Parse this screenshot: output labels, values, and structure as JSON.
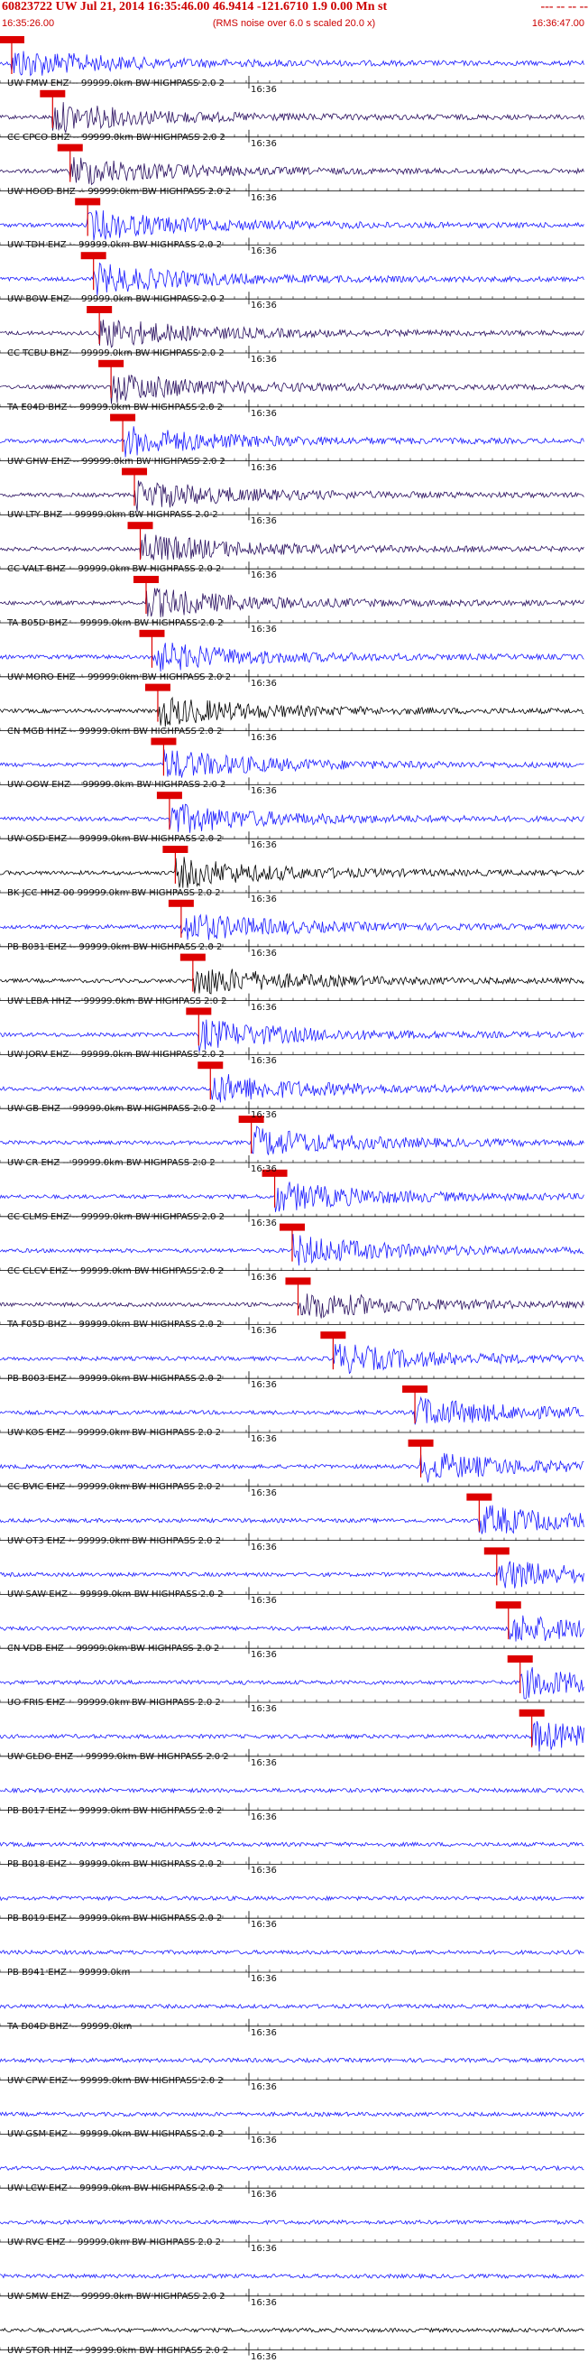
{
  "header": {
    "title": "60823722 UW Jul 21, 2014 16:35:46.00   46.9414 -121.6710  1.9 0.00 Mn st",
    "title_end": "--- -- -- --",
    "start_time": "16:35:26.00",
    "noise_note": "(RMS noise over 6.0 s scaled 20.0 x)",
    "end_time": "16:36:47.00"
  },
  "minute_label": "16:36",
  "colors": {
    "blue": "#1a1aff",
    "dark": "#2a1060",
    "black": "#000000",
    "pick": "#dd0000",
    "label_red": "#cc0000"
  },
  "traces": [
    {
      "label": "UW FMW EHZ -- 99999.0km BW  HIGHPASS  2.0  2",
      "color": "blue",
      "pick": 0.02
    },
    {
      "label": "CC CPCO BHZ -- 99999.0km BW  HIGHPASS  2.0  2",
      "color": "dark",
      "pick": 0.09
    },
    {
      "label": "UW HOOD BHZ -- 99999.0km BW  HIGHPASS  2.0  2",
      "color": "dark",
      "pick": 0.12
    },
    {
      "label": "UW TDH EHZ -- 99999.0km BW  HIGHPASS  2.0  2",
      "color": "blue",
      "pick": 0.15
    },
    {
      "label": "UW BOW EHZ -- 99999.0km BW  HIGHPASS  2.0  2",
      "color": "blue",
      "pick": 0.16
    },
    {
      "label": "CC TCBU BHZ -- 99999.0km BW  HIGHPASS  2.0  2",
      "color": "dark",
      "pick": 0.17
    },
    {
      "label": "TA E04D BHZ -- 99999.0km BW  HIGHPASS  2.0  2",
      "color": "dark",
      "pick": 0.19
    },
    {
      "label": "UW GHW EHZ -- 99999.0km BW  HIGHPASS  2.0  2",
      "color": "blue",
      "pick": 0.21
    },
    {
      "label": "UW LTY BHZ -- 99999.0km BW  HIGHPASS  2.0  2",
      "color": "dark",
      "pick": 0.23
    },
    {
      "label": "CC VALT BHZ -- 99999.0km BW  HIGHPASS  2.0  2",
      "color": "dark",
      "pick": 0.24
    },
    {
      "label": "TA B05D BHZ -- 99999.0km BW  HIGHPASS  2.0  2",
      "color": "dark",
      "pick": 0.25
    },
    {
      "label": "UW MORO EHZ -- 99999.0km BW  HIGHPASS  2.0  2",
      "color": "blue",
      "pick": 0.26
    },
    {
      "label": "CN MGB HHZ -- 99999.0km BW  HIGHPASS  2.0  2",
      "color": "black",
      "pick": 0.27
    },
    {
      "label": "UW OOW EHZ -- 99999.0km BW  HIGHPASS  2.0  2",
      "color": "blue",
      "pick": 0.28
    },
    {
      "label": "UW OSD EHZ -- 99999.0km BW  HIGHPASS  2.0  2",
      "color": "blue",
      "pick": 0.29
    },
    {
      "label": "BK JCC HHZ 00 99999.0km BW  HIGHPASS  2.0  2",
      "color": "black",
      "pick": 0.3
    },
    {
      "label": "PB B031 EHZ -- 99999.0km BW  HIGHPASS  2.0  2",
      "color": "blue",
      "pick": 0.31
    },
    {
      "label": "UW LEBA HHZ -- 99999.0km BW  HIGHPASS  2.0  2",
      "color": "black",
      "pick": 0.33
    },
    {
      "label": "UW JORV EHZ -- 99999.0km BW  HIGHPASS  2.0  2",
      "color": "blue",
      "pick": 0.34
    },
    {
      "label": "UW GB EHZ -- 99999.0km BW  HIGHPASS  2.0  2",
      "color": "blue",
      "pick": 0.36
    },
    {
      "label": "UW CR EHZ -- 99999.0km BW  HIGHPASS  2.0  2",
      "color": "blue",
      "pick": 0.43
    },
    {
      "label": "CC CLMS EHZ -- 99999.0km BW  HIGHPASS  2.0  2",
      "color": "blue",
      "pick": 0.47
    },
    {
      "label": "CC CLCV EHZ -- 99999.0km BW  HIGHPASS  2.0  2",
      "color": "blue",
      "pick": 0.5
    },
    {
      "label": "TA F05D BHZ -- 99999.0km BW  HIGHPASS  2.0  2",
      "color": "dark",
      "pick": 0.51
    },
    {
      "label": "PB B003 EHZ -- 99999.0km BW  HIGHPASS  2.0  2",
      "color": "blue",
      "pick": 0.57
    },
    {
      "label": "UW KOS EHZ -- 99999.0km BW  HIGHPASS  2.0  2",
      "color": "blue",
      "pick": 0.71
    },
    {
      "label": "CC BVIC EHZ -- 99999.0km BW  HIGHPASS  2.0  2",
      "color": "blue",
      "pick": 0.72
    },
    {
      "label": "UW OT3 EHZ -- 99999.0km BW  HIGHPASS  2.0  2",
      "color": "blue",
      "pick": 0.82
    },
    {
      "label": "UW SAW EHZ -- 99999.0km BW  HIGHPASS  2.0  2",
      "color": "blue",
      "pick": 0.85
    },
    {
      "label": "CN VDB EHZ -- 99999.0km BW  HIGHPASS  2.0  2",
      "color": "blue",
      "pick": 0.87
    },
    {
      "label": "UO FRIS EHZ -- 99999.0km BW  HIGHPASS  2.0  2",
      "color": "blue",
      "pick": 0.89
    },
    {
      "label": "UW GLDO EHZ -- 99999.0km BW  HIGHPASS  2.0  2",
      "color": "blue",
      "pick": 0.91
    },
    {
      "label": "PB B017 EHZ -- 99999.0km BW  HIGHPASS  2.0  2",
      "color": "blue",
      "pick": null
    },
    {
      "label": "PB B018 EHZ -- 99999.0km BW  HIGHPASS  2.0  2",
      "color": "blue",
      "pick": null
    },
    {
      "label": "PB B019 EHZ -- 99999.0km BW  HIGHPASS  2.0  2",
      "color": "blue",
      "pick": null
    },
    {
      "label": "PB B941 EHZ -- 99999.0km",
      "color": "blue",
      "pick": null
    },
    {
      "label": "TA D04D BHZ -- 99999.0km",
      "color": "blue",
      "pick": null
    },
    {
      "label": "UW CPW EHZ -- 99999.0km BW  HIGHPASS  2.0  2",
      "color": "blue",
      "pick": null
    },
    {
      "label": "UW GSM EHZ -- 99999.0km BW  HIGHPASS  2.0  2",
      "color": "blue",
      "pick": null
    },
    {
      "label": "UW LCW EHZ -- 99999.0km BW  HIGHPASS  2.0  2",
      "color": "blue",
      "pick": null
    },
    {
      "label": "UW RVC EHZ -- 99999.0km BW  HIGHPASS  2.0  2",
      "color": "blue",
      "pick": null
    },
    {
      "label": "UW SMW EHZ -- 99999.0km BW  HIGHPASS  2.0  2",
      "color": "blue",
      "pick": null
    },
    {
      "label": "UW STOR HHZ -- 99999.0km BW  HIGHPASS  2.0  2",
      "color": "black",
      "pick": null
    }
  ]
}
